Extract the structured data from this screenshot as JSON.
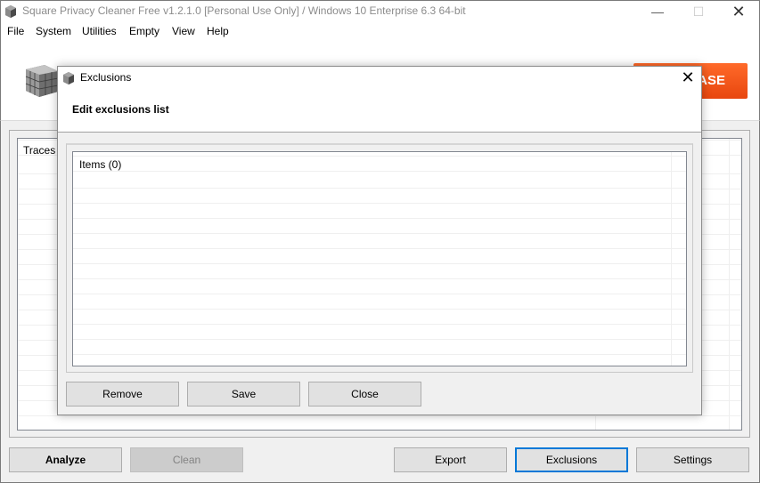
{
  "window": {
    "title": "Square Privacy Cleaner Free v1.2.1.0 [Personal Use Only] / Windows 10 Enterprise 6.3 64-bit",
    "minimize_glyph": "—",
    "maximize_glyph": "☐",
    "close_glyph": "✕"
  },
  "menu": {
    "items": [
      "File",
      "System",
      "Utilities",
      "Empty",
      "View",
      "Help"
    ]
  },
  "header": {
    "purchase_label": "ASE",
    "brand_color": "#f0561c"
  },
  "traces": {
    "column_header": "Traces"
  },
  "bottom_buttons": {
    "analyze": "Analyze",
    "clean": "Clean",
    "export": "Export",
    "exclusions": "Exclusions",
    "settings": "Settings"
  },
  "dialog": {
    "title": "Exclusions",
    "close_glyph": "✕",
    "heading": "Edit exclusions list",
    "items_header": "Items (0)",
    "buttons": {
      "remove": "Remove",
      "save": "Save",
      "close": "Close"
    }
  },
  "icons": {
    "app": "cube-icon",
    "logo": "cube-logo-icon"
  }
}
